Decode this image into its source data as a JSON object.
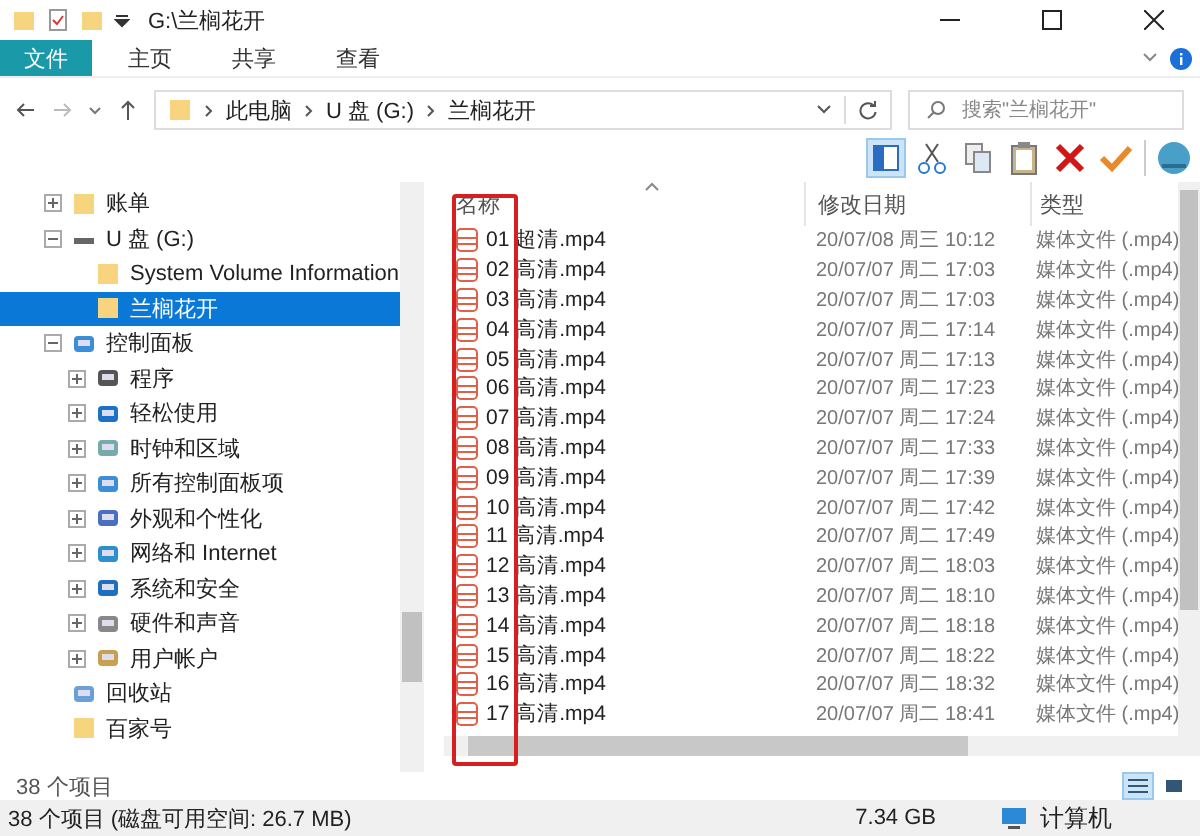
{
  "window": {
    "title": "G:\\兰榈花开"
  },
  "ribbon_tabs": [
    {
      "label": "文件",
      "selected": true
    },
    {
      "label": "主页",
      "selected": false
    },
    {
      "label": "共享",
      "selected": false
    },
    {
      "label": "查看",
      "selected": false
    }
  ],
  "address": {
    "crumbs": [
      "此电脑",
      "U 盘 (G:)",
      "兰榈花开"
    ]
  },
  "search": {
    "placeholder": "搜索\"兰榈花开\""
  },
  "tree": [
    {
      "label": "账单",
      "kind": "folder",
      "expanded": false,
      "selected": false
    },
    {
      "label": "U 盘 (G:)",
      "kind": "drive",
      "expanded": true,
      "selected": false,
      "children": [
        {
          "label": "System Volume Information",
          "kind": "folder",
          "selected": false
        },
        {
          "label": "兰榈花开",
          "kind": "folder",
          "selected": true
        }
      ]
    },
    {
      "label": "控制面板",
      "kind": "panel",
      "expanded": true,
      "selected": false,
      "children": [
        {
          "label": "程序",
          "kind": "program",
          "expanded": false,
          "selected": false
        },
        {
          "label": "轻松使用",
          "kind": "access",
          "expanded": false,
          "selected": false
        },
        {
          "label": "时钟和区域",
          "kind": "clock",
          "expanded": false,
          "selected": false
        },
        {
          "label": "所有控制面板项",
          "kind": "panel",
          "expanded": false,
          "selected": false
        },
        {
          "label": "外观和个性化",
          "kind": "appearance",
          "expanded": false,
          "selected": false
        },
        {
          "label": "网络和 Internet",
          "kind": "network",
          "expanded": false,
          "selected": false
        },
        {
          "label": "系统和安全",
          "kind": "security",
          "expanded": false,
          "selected": false
        },
        {
          "label": "硬件和声音",
          "kind": "hardware",
          "expanded": false,
          "selected": false
        },
        {
          "label": "用户帐户",
          "kind": "users",
          "expanded": false,
          "selected": false
        }
      ]
    },
    {
      "label": "回收站",
      "kind": "recycle",
      "selected": false
    },
    {
      "label": "百家号",
      "kind": "folder",
      "selected": false
    }
  ],
  "table": {
    "columns": [
      "名称",
      "修改日期",
      "类型"
    ],
    "rows": [
      [
        "01 超清.mp4",
        "20/07/08 周三 10:12",
        "媒体文件 (.mp4)"
      ],
      [
        "02 高清.mp4",
        "20/07/07 周二 17:03",
        "媒体文件 (.mp4)"
      ],
      [
        "03 高清.mp4",
        "20/07/07 周二 17:03",
        "媒体文件 (.mp4)"
      ],
      [
        "04 高清.mp4",
        "20/07/07 周二 17:14",
        "媒体文件 (.mp4)"
      ],
      [
        "05 高清.mp4",
        "20/07/07 周二 17:13",
        "媒体文件 (.mp4)"
      ],
      [
        "06 高清.mp4",
        "20/07/07 周二 17:23",
        "媒体文件 (.mp4)"
      ],
      [
        "07 高清.mp4",
        "20/07/07 周二 17:24",
        "媒体文件 (.mp4)"
      ],
      [
        "08 高清.mp4",
        "20/07/07 周二 17:33",
        "媒体文件 (.mp4)"
      ],
      [
        "09 高清.mp4",
        "20/07/07 周二 17:39",
        "媒体文件 (.mp4)"
      ],
      [
        "10 高清.mp4",
        "20/07/07 周二 17:42",
        "媒体文件 (.mp4)"
      ],
      [
        "11 高清.mp4",
        "20/07/07 周二 17:49",
        "媒体文件 (.mp4)"
      ],
      [
        "12 高清.mp4",
        "20/07/07 周二 18:03",
        "媒体文件 (.mp4)"
      ],
      [
        "13 高清.mp4",
        "20/07/07 周二 18:10",
        "媒体文件 (.mp4)"
      ],
      [
        "14 高清.mp4",
        "20/07/07 周二 18:18",
        "媒体文件 (.mp4)"
      ],
      [
        "15 高清.mp4",
        "20/07/07 周二 18:22",
        "媒体文件 (.mp4)"
      ],
      [
        "16 高清.mp4",
        "20/07/07 周二 18:32",
        "媒体文件 (.mp4)"
      ],
      [
        "17 高清.mp4",
        "20/07/07 周二 18:41",
        "媒体文件 (.mp4)"
      ]
    ]
  },
  "item_count": "38 个项目",
  "views": [
    {
      "kind": "details",
      "selected": true
    },
    {
      "kind": "tiles",
      "selected": false
    }
  ],
  "status_bar": {
    "summary": "38 个项目 (磁盘可用空间: 26.7 MB)",
    "size": "7.34 GB",
    "location": "计算机"
  }
}
